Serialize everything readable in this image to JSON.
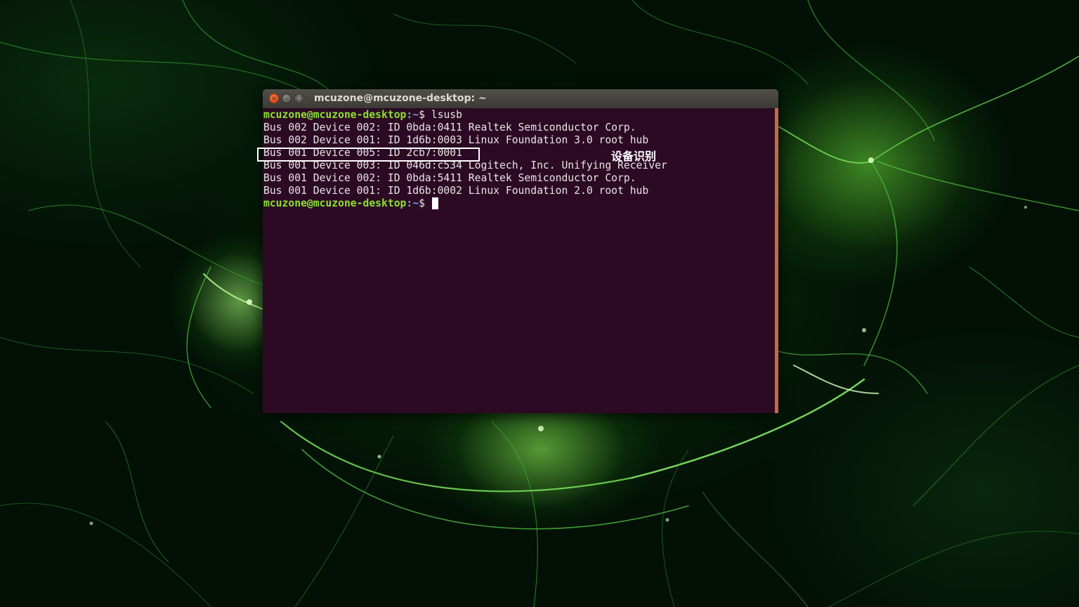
{
  "window": {
    "title": "mcuzone@mcuzone-desktop: ~",
    "close_glyph": "×",
    "minimize_glyph": "–",
    "maximize_glyph": "□"
  },
  "terminal": {
    "prompt_user": "mcuzone@mcuzone-desktop",
    "prompt_path": ":~",
    "prompt_sign": "$",
    "command": " lsusb",
    "output": [
      "Bus 002 Device 002: ID 0bda:0411 Realtek Semiconductor Corp.",
      "Bus 002 Device 001: ID 1d6b:0003 Linux Foundation 3.0 root hub",
      "Bus 001 Device 005: ID 2cb7:0001",
      "Bus 001 Device 003: ID 046d:c534 Logitech, Inc. Unifying Receiver",
      "Bus 001 Device 002: ID 0bda:5411 Realtek Semiconductor Corp.",
      "Bus 001 Device 001: ID 1d6b:0002 Linux Foundation 2.0 root hub"
    ],
    "final_prompt_sign": "$ "
  },
  "annotation": {
    "label": "设备识别"
  },
  "colors": {
    "terminal_bg": "#2c0a24",
    "prompt_user": "#8ae234",
    "prompt_path": "#729fcf",
    "text": "#e8e6e3"
  }
}
